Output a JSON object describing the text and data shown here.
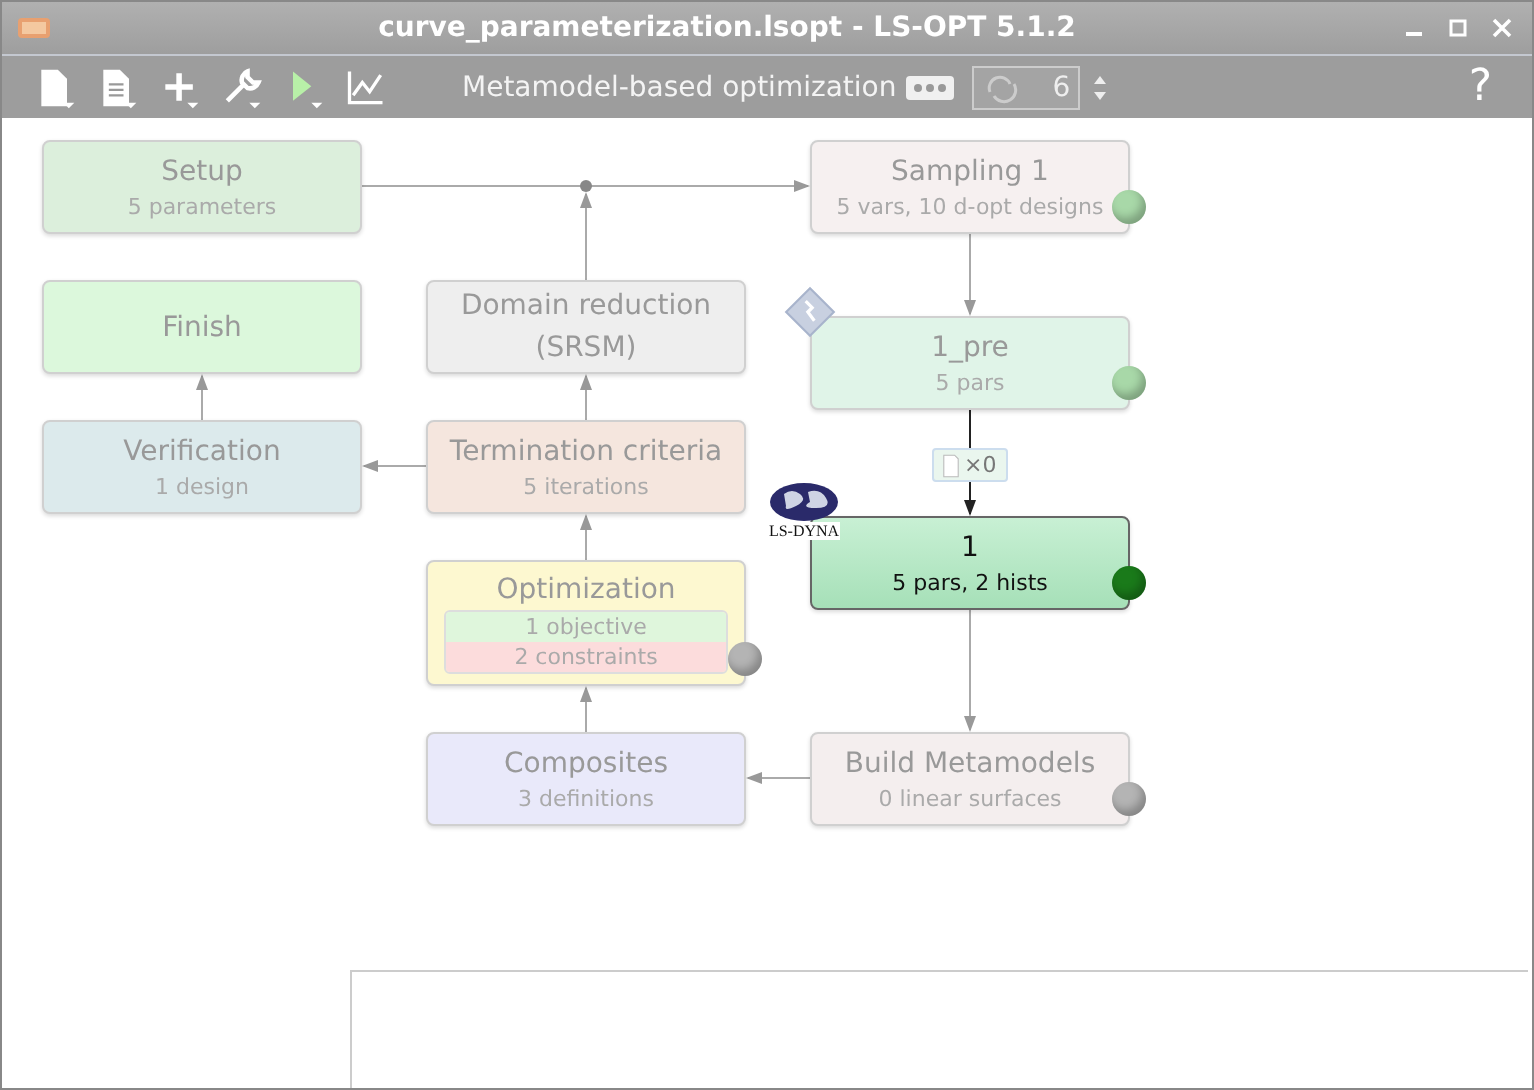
{
  "window": {
    "title": "curve_parameterization.lsopt - LS-OPT 5.1.2"
  },
  "toolbar": {
    "mode": "Metamodel-based optimization",
    "iterations": "6",
    "help": "?"
  },
  "nodes": [
    {
      "title": "Setup",
      "subtitle": "5 parameters",
      "kind": "setup",
      "active": false
    },
    {
      "title": "Sampling 1",
      "subtitle": "5 vars, 10 d-opt designs",
      "kind": "sampling",
      "active": false,
      "color": "#a8d8a8"
    },
    {
      "title": "Finish",
      "kind": "finish",
      "active": false
    },
    {
      "title": "Domain reduction (SRSM)",
      "kind": "domain",
      "active": false
    },
    {
      "title": "1_pre",
      "subtitle": "5 pars",
      "kind": "stage",
      "active": false,
      "color": "#a8d8a8"
    },
    {
      "title": "Verification",
      "subtitle": "1 design",
      "kind": "verification",
      "active": false
    },
    {
      "title": "Termination criteria",
      "subtitle": "5 iterations",
      "kind": "termination",
      "active": false
    },
    {
      "title": "1",
      "subtitle": "5 pars, 2 hists",
      "kind": "stage",
      "active": true,
      "color": "#1a7a1a"
    },
    {
      "title": "Optimization",
      "kind": "optimization",
      "active": false,
      "color": "#b4b4b4",
      "items": [
        {
          "label": "1 objective",
          "kind": "objective"
        },
        {
          "label": "2 constraints",
          "kind": "constraint"
        }
      ]
    },
    {
      "title": "Composites",
      "subtitle": "3 definitions",
      "kind": "composites",
      "active": false
    },
    {
      "title": "Build Metamodels",
      "subtitle": "0 linear surfaces",
      "kind": "metamodels",
      "active": false,
      "color": "#b4b4b4"
    }
  ],
  "file_badge": {
    "count": "×0"
  },
  "solver_logo": {
    "label": "LS-DYNA"
  }
}
